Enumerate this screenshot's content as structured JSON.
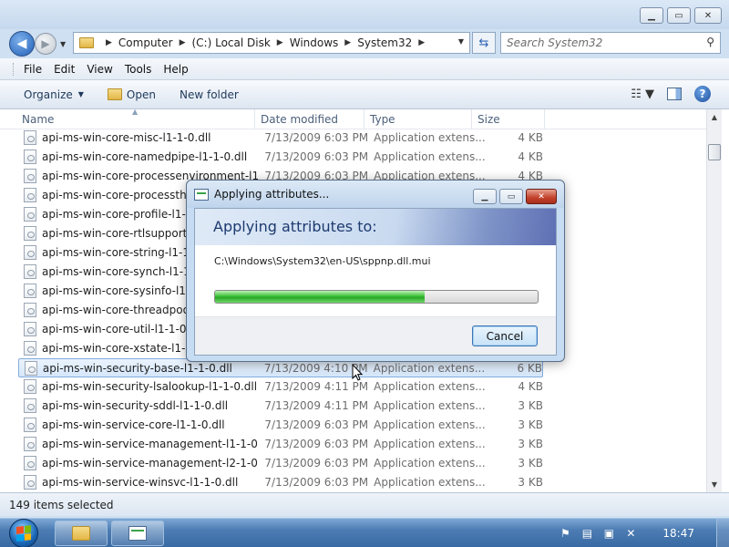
{
  "window": {
    "title_buttons": [
      "minimize",
      "maximize",
      "close"
    ]
  },
  "address": {
    "breadcrumbs": [
      "Computer",
      "(C:) Local Disk",
      "Windows",
      "System32"
    ],
    "search_placeholder": "Search System32"
  },
  "menu": {
    "items": [
      "File",
      "Edit",
      "View",
      "Tools",
      "Help"
    ]
  },
  "commands": {
    "organize": "Organize",
    "open": "Open",
    "new_folder": "New folder"
  },
  "columns": {
    "name": "Name",
    "date": "Date modified",
    "type": "Type",
    "size": "Size"
  },
  "files": [
    {
      "name": "api-ms-win-core-misc-l1-1-0.dll",
      "date": "7/13/2009 6:03 PM",
      "type": "Application extens...",
      "size": "4 KB"
    },
    {
      "name": "api-ms-win-core-namedpipe-l1-1-0.dll",
      "date": "7/13/2009 6:03 PM",
      "type": "Application extens...",
      "size": "4 KB"
    },
    {
      "name": "api-ms-win-core-processenvironment-l1...",
      "date": "7/13/2009 6:03 PM",
      "type": "Application extens...",
      "size": "4 KB"
    },
    {
      "name": "api-ms-win-core-processthrea",
      "date": "",
      "type": "",
      "size": ""
    },
    {
      "name": "api-ms-win-core-profile-l1-1",
      "date": "",
      "type": "",
      "size": ""
    },
    {
      "name": "api-ms-win-core-rtlsupport-l1",
      "date": "",
      "type": "",
      "size": ""
    },
    {
      "name": "api-ms-win-core-string-l1-1-0",
      "date": "",
      "type": "",
      "size": ""
    },
    {
      "name": "api-ms-win-core-synch-l1-1-0",
      "date": "",
      "type": "",
      "size": ""
    },
    {
      "name": "api-ms-win-core-sysinfo-l1-1",
      "date": "",
      "type": "",
      "size": ""
    },
    {
      "name": "api-ms-win-core-threadpool-",
      "date": "",
      "type": "",
      "size": ""
    },
    {
      "name": "api-ms-win-core-util-l1-1-0.d",
      "date": "",
      "type": "",
      "size": ""
    },
    {
      "name": "api-ms-win-core-xstate-l1-1-0",
      "date": "",
      "type": "",
      "size": ""
    },
    {
      "name": "api-ms-win-security-base-l1-1-0.dll",
      "date": "7/13/2009 4:10 PM",
      "type": "Application extens...",
      "size": "6 KB",
      "selected": true
    },
    {
      "name": "api-ms-win-security-lsalookup-l1-1-0.dll",
      "date": "7/13/2009 4:11 PM",
      "type": "Application extens...",
      "size": "4 KB"
    },
    {
      "name": "api-ms-win-security-sddl-l1-1-0.dll",
      "date": "7/13/2009 4:11 PM",
      "type": "Application extens...",
      "size": "3 KB"
    },
    {
      "name": "api-ms-win-service-core-l1-1-0.dll",
      "date": "7/13/2009 6:03 PM",
      "type": "Application extens...",
      "size": "3 KB"
    },
    {
      "name": "api-ms-win-service-management-l1-1-0....",
      "date": "7/13/2009 6:03 PM",
      "type": "Application extens...",
      "size": "3 KB"
    },
    {
      "name": "api-ms-win-service-management-l2-1-0....",
      "date": "7/13/2009 6:03 PM",
      "type": "Application extens...",
      "size": "3 KB"
    },
    {
      "name": "api-ms-win-service-winsvc-l1-1-0.dll",
      "date": "7/13/2009 6:03 PM",
      "type": "Application extens...",
      "size": "3 KB"
    }
  ],
  "status": {
    "text": "149 items selected"
  },
  "dialog": {
    "title": "Applying attributes...",
    "heading": "Applying attributes to:",
    "path": "C:\\Windows\\System32\\en-US\\sppnp.dll.mui",
    "progress_percent": 65,
    "cancel_label": "Cancel"
  },
  "taskbar": {
    "clock": "18:47"
  }
}
